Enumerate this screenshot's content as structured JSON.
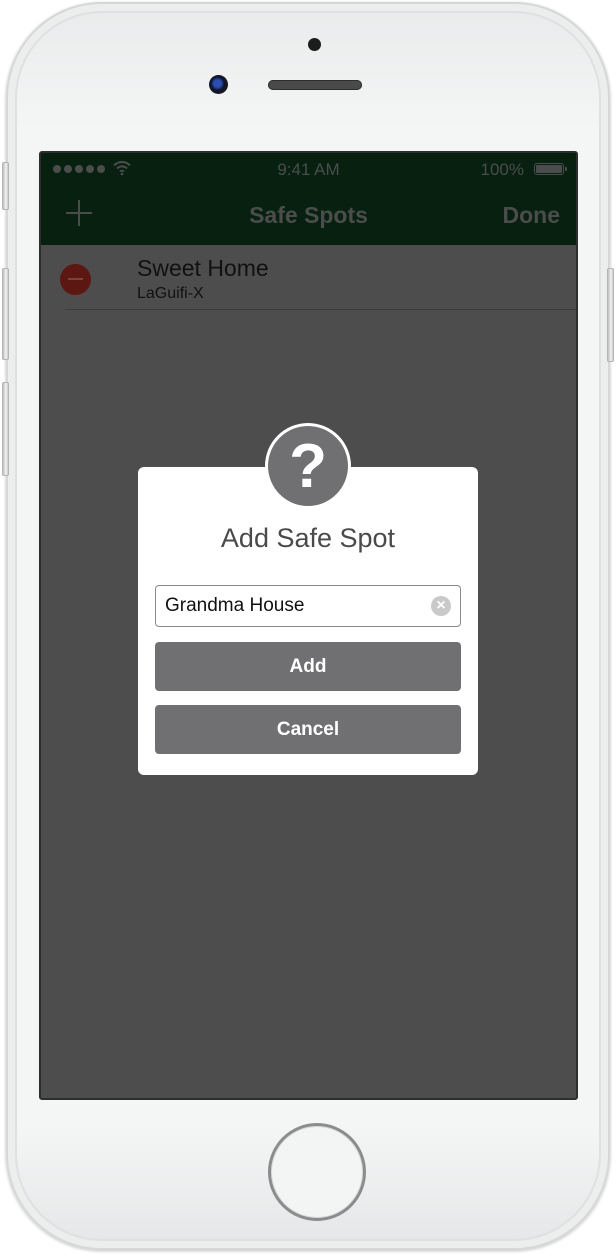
{
  "status_bar": {
    "signal_icon": "cellular-signal-dots",
    "wifi_icon": "wifi-icon",
    "time": "9:41 AM",
    "battery_percent": "100%",
    "battery_icon": "battery-full-icon"
  },
  "nav_bar": {
    "add_icon": "plus-icon",
    "title": "Safe Spots",
    "done_label": "Done",
    "background_color": "#072010"
  },
  "list": {
    "items": [
      {
        "title": "Sweet Home",
        "subtitle": "LaGuifi-X",
        "delete_icon": "minus-circle-icon"
      }
    ]
  },
  "dialog": {
    "icon": "question-mark-icon",
    "title": "Add Safe Spot",
    "input_value": "Grandma House",
    "clear_icon": "clear-circle-icon",
    "add_label": "Add",
    "cancel_label": "Cancel",
    "button_color": "#707072"
  },
  "device": {
    "home_button_icon": "home-button"
  }
}
